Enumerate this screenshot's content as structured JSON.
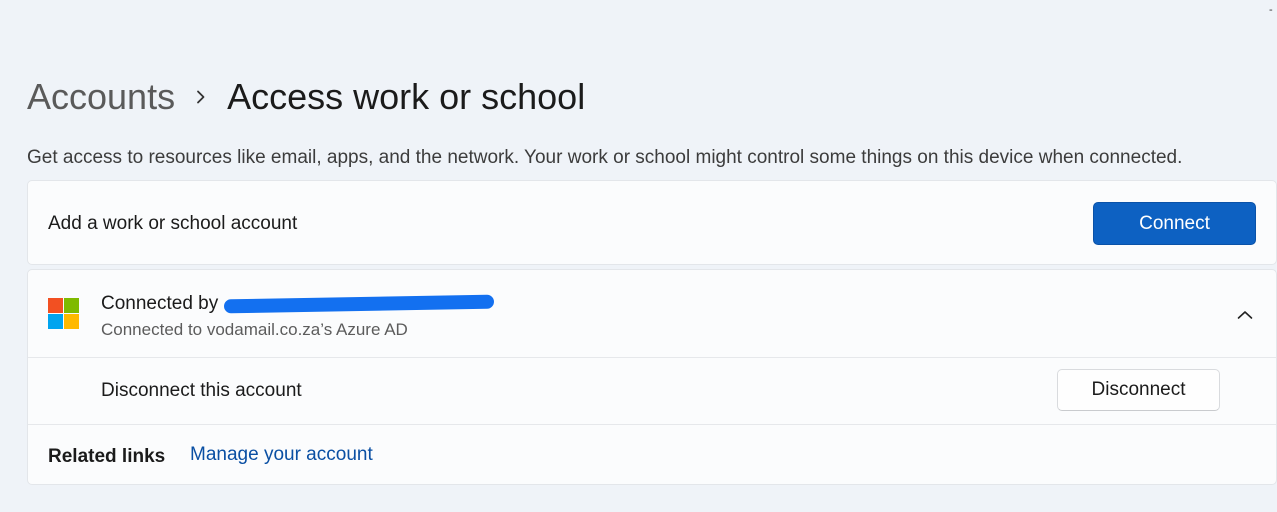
{
  "breadcrumb": {
    "parent": "Accounts",
    "current": "Access work or school"
  },
  "description": "Get access to resources like email, apps, and the network. Your work or school might control some things on this device when connected.",
  "add_account": {
    "label": "Add a work or school account",
    "button_label": "Connect"
  },
  "account": {
    "title_prefix": "Connected by",
    "subtitle": "Connected to vodamail.co.za’s Azure AD",
    "disconnect_label": "Disconnect this account",
    "disconnect_button": "Disconnect",
    "expanded": true
  },
  "related": {
    "label": "Related links",
    "link": "Manage your account"
  },
  "icons": {
    "logo": "microsoft-logo-icon",
    "expand": "chevron-up-icon",
    "separator": "chevron-right-icon"
  },
  "colors": {
    "accent": "#0d61c2",
    "link": "#0a4fa3",
    "redaction": "#1370f0",
    "ms_red": "#f25022",
    "ms_green": "#7fba00",
    "ms_blue": "#00a4ef",
    "ms_yellow": "#ffb900"
  }
}
